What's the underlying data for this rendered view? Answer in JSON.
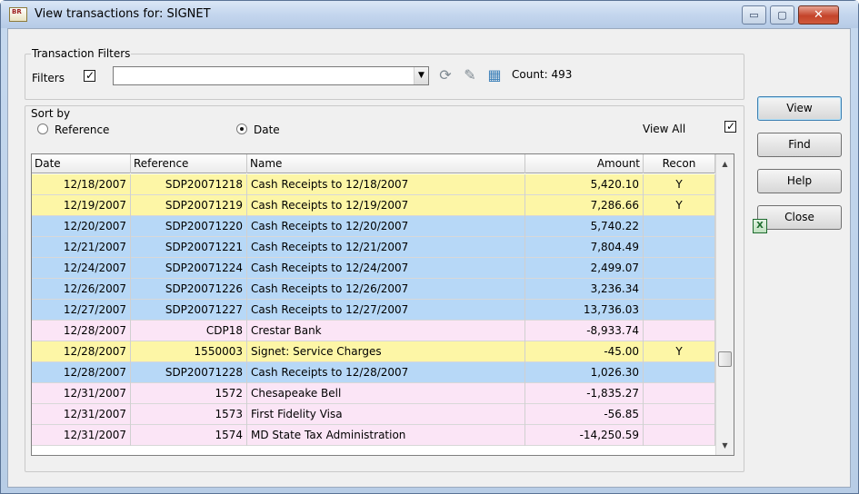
{
  "window": {
    "icon_text": "BR",
    "title": "View transactions for: SIGNET",
    "min_glyph": "▭",
    "max_glyph": "▢",
    "close_glyph": "✕"
  },
  "filters": {
    "group_label": "Transaction Filters",
    "filters_label": "Filters",
    "filters_checked": true,
    "filter_value": "",
    "count_label": "Count: 493"
  },
  "sort": {
    "group_label": "Sort by",
    "options": [
      "Reference",
      "Date"
    ],
    "selected": "Date",
    "view_all_label": "View All",
    "view_all_checked": true
  },
  "buttons": {
    "view": "View",
    "find": "Find",
    "help": "Help",
    "close": "Close"
  },
  "colors": {
    "yellow": "#fdf6a6",
    "blue": "#b7d8f7",
    "pink": "#fbe5f6"
  },
  "table": {
    "columns": [
      "Date",
      "Reference",
      "Name",
      "Amount",
      "Recon"
    ],
    "rows": [
      {
        "date": "12/18/2007",
        "reference": "SDP20071218",
        "name": "Cash Receipts to 12/18/2007",
        "amount": "5,420.10",
        "recon": "Y",
        "color": "yellow"
      },
      {
        "date": "12/19/2007",
        "reference": "SDP20071219",
        "name": "Cash Receipts to 12/19/2007",
        "amount": "7,286.66",
        "recon": "Y",
        "color": "yellow"
      },
      {
        "date": "12/20/2007",
        "reference": "SDP20071220",
        "name": "Cash Receipts to 12/20/2007",
        "amount": "5,740.22",
        "recon": "",
        "color": "blue"
      },
      {
        "date": "12/21/2007",
        "reference": "SDP20071221",
        "name": "Cash Receipts to 12/21/2007",
        "amount": "7,804.49",
        "recon": "",
        "color": "blue"
      },
      {
        "date": "12/24/2007",
        "reference": "SDP20071224",
        "name": "Cash Receipts to 12/24/2007",
        "amount": "2,499.07",
        "recon": "",
        "color": "blue"
      },
      {
        "date": "12/26/2007",
        "reference": "SDP20071226",
        "name": "Cash Receipts to 12/26/2007",
        "amount": "3,236.34",
        "recon": "",
        "color": "blue"
      },
      {
        "date": "12/27/2007",
        "reference": "SDP20071227",
        "name": "Cash Receipts to 12/27/2007",
        "amount": "13,736.03",
        "recon": "",
        "color": "blue"
      },
      {
        "date": "12/28/2007",
        "reference": "CDP18",
        "name": "Crestar Bank",
        "amount": "-8,933.74",
        "recon": "",
        "color": "pink"
      },
      {
        "date": "12/28/2007",
        "reference": "1550003",
        "name": "Signet: Service Charges",
        "amount": "-45.00",
        "recon": "Y",
        "color": "yellow"
      },
      {
        "date": "12/28/2007",
        "reference": "SDP20071228",
        "name": "Cash Receipts to 12/28/2007",
        "amount": "1,026.30",
        "recon": "",
        "color": "blue"
      },
      {
        "date": "12/31/2007",
        "reference": "1572",
        "name": "Chesapeake Bell",
        "amount": "-1,835.27",
        "recon": "",
        "color": "pink"
      },
      {
        "date": "12/31/2007",
        "reference": "1573",
        "name": "First Fidelity Visa",
        "amount": "-56.85",
        "recon": "",
        "color": "pink"
      },
      {
        "date": "12/31/2007",
        "reference": "1574",
        "name": "MD State Tax Administration",
        "amount": "-14,250.59",
        "recon": "",
        "color": "pink"
      }
    ]
  }
}
